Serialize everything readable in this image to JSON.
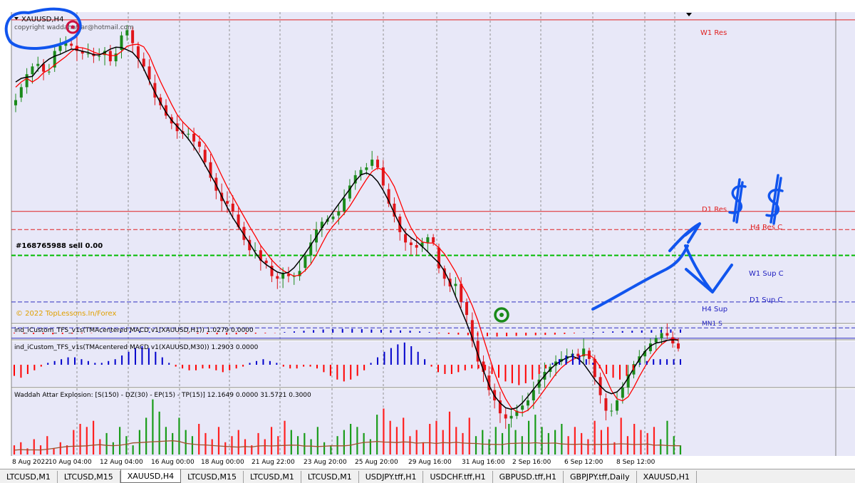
{
  "window": {
    "symbol_title": "XAUUSD,H4",
    "copyright": "copyright waddahattar@hotmail.com",
    "watermark": "© 2022 TopLessons.In/Forex",
    "order_label": "#168765988 sell 0.00"
  },
  "colors": {
    "plot_bg": "#e8e8f8",
    "bull": "#1b8a1b",
    "bear": "#e0161b",
    "tma_red": "#ff0000",
    "tma_black": "#000000",
    "macd_blue": "#0000cc",
    "macd_red": "#ff0000",
    "waddah_green": "#1a9c1a",
    "waddah_red": "#ff2020",
    "waddah_line": "#a0522d",
    "res_line": "#e02020",
    "sup_line": "#3030c0",
    "order_line": "#00bb00",
    "annotation": "#1155ee"
  },
  "chart_data": [
    {
      "type": "candlestick",
      "title": "XAUUSD,H4",
      "x_ticks": [
        "8 Aug 2022",
        "10 Aug 04:00",
        "12 Aug 04:00",
        "16 Aug 00:00",
        "18 Aug 00:00",
        "21 Aug 22:00",
        "23 Aug 20:00",
        "25 Aug 20:00",
        "29 Aug 16:00",
        "31 Aug 16:00",
        "2 Sep 16:00",
        "6 Sep 12:00",
        "8 Sep 12:00"
      ],
      "ylim": [
        1690,
        1810
      ],
      "closes": [
        1776,
        1781,
        1786,
        1789,
        1790,
        1787,
        1787,
        1795,
        1797,
        1798,
        1797,
        1795,
        1794,
        1794,
        1793,
        1793,
        1795,
        1791,
        1794,
        1801,
        1803,
        1798,
        1792,
        1789,
        1784,
        1777,
        1774,
        1770,
        1767,
        1764,
        1763,
        1763,
        1760,
        1758,
        1752,
        1746,
        1741,
        1737,
        1736,
        1733,
        1727,
        1722,
        1718,
        1718,
        1714,
        1713,
        1708,
        1707,
        1709,
        1708,
        1708,
        1710,
        1716,
        1721,
        1726,
        1729,
        1730,
        1731,
        1733,
        1738,
        1743,
        1747,
        1749,
        1750,
        1753,
        1750,
        1743,
        1736,
        1731,
        1725,
        1721,
        1720,
        1719,
        1721,
        1723,
        1721,
        1711,
        1707,
        1704,
        1705,
        1698,
        1693,
        1683,
        1675,
        1671,
        1664,
        1660,
        1655,
        1653,
        1654,
        1656,
        1658,
        1660,
        1664,
        1668,
        1671,
        1673,
        1675,
        1676,
        1677,
        1678,
        1677,
        1680,
        1676,
        1669,
        1662,
        1656,
        1656,
        1660,
        1665,
        1670,
        1674,
        1677,
        1679,
        1682,
        1684,
        1686,
        1685,
        1682,
        1680
      ],
      "bull_color": "#1b8a1b",
      "bear_color": "#e0161b"
    },
    {
      "type": "bar",
      "title": "ind_iCustom_TFS_v1s(TMAcentered MACD v1(XAUUSD,H1)) 1.0279 0.0000",
      "values": [
        -0.1,
        -0.15,
        -0.2,
        -0.2,
        -0.25,
        -0.2,
        -0.15,
        -0.1,
        -0.05,
        0.05,
        0.1,
        0.15,
        0.2,
        0.2,
        0.15,
        0.1,
        0.05,
        -0.05,
        -0.1,
        -0.15,
        -0.2,
        -0.25,
        -0.3,
        -0.25,
        -0.2,
        -0.15,
        -0.1,
        -0.05,
        0.1,
        0.2,
        0.3,
        0.4,
        0.5,
        0.55,
        0.6,
        0.6,
        0.55,
        0.5,
        0.45,
        0.4,
        0.35,
        0.3,
        0.2,
        0.1,
        -0.1,
        -0.2,
        -0.3,
        -0.4,
        -0.5,
        -0.55,
        -0.6,
        -0.55,
        -0.5,
        -0.45,
        -0.4,
        -0.35,
        -0.3,
        -0.2,
        -0.1,
        0.05,
        0.1,
        0.15,
        0.2,
        0.25,
        0.3,
        0.35,
        0.4,
        0.45,
        0.5,
        0.5
      ]
    },
    {
      "type": "bar",
      "title": "ind_iCustom_TFS_v1s(TMAcentered MACD v1(XAUUSD,M30)) 1.2903 0.0000",
      "values": [
        -0.6,
        -0.7,
        -0.5,
        -0.3,
        -0.1,
        0.1,
        0.2,
        0.3,
        0.4,
        0.4,
        0.3,
        0.2,
        0.1,
        0.1,
        0.2,
        0.3,
        0.5,
        0.7,
        0.9,
        1.0,
        0.9,
        0.7,
        0.4,
        0.1,
        -0.1,
        -0.2,
        -0.3,
        -0.3,
        -0.2,
        -0.2,
        -0.3,
        -0.4,
        -0.3,
        -0.2,
        -0.1,
        0.1,
        0.2,
        0.3,
        0.2,
        0.1,
        -0.1,
        -0.2,
        -0.2,
        -0.1,
        -0.1,
        -0.2,
        -0.4,
        -0.6,
        -0.8,
        -0.9,
        -0.8,
        -0.6,
        -0.3,
        0.1,
        0.4,
        0.7,
        0.9,
        1.1,
        1.2,
        1.0,
        0.7,
        0.3,
        -0.1,
        -0.4,
        -0.5,
        -0.5,
        -0.4,
        -0.3,
        -0.2,
        -0.2,
        -0.3,
        -0.5,
        -0.7,
        -0.9,
        -1.0,
        -1.1,
        -1.0,
        -0.8,
        -0.5,
        -0.2,
        0.1,
        0.3,
        0.5,
        0.6,
        0.5,
        0.3,
        0.1,
        -0.2,
        -0.5,
        -0.7,
        -0.8,
        -0.6,
        -0.3,
        0.1,
        0.2,
        0.3,
        0.3,
        0.3,
        0.3,
        0.3
      ]
    },
    {
      "type": "bar",
      "title": "Waddah Attar Explosion: [S(150) - DZ(30) - EP(15) - TP(15)] 12.1649 0.0000 31.5721 0.3000",
      "values": [
        3,
        4,
        2,
        5,
        3,
        6,
        2,
        4,
        3,
        8,
        10,
        9,
        11,
        5,
        7,
        4,
        9,
        6,
        3,
        8,
        12,
        18,
        14,
        9,
        7,
        12,
        8,
        6,
        10,
        7,
        5,
        9,
        4,
        6,
        8,
        5,
        3,
        7,
        5,
        9,
        6,
        11,
        8,
        6,
        7,
        5,
        9,
        4,
        3,
        6,
        8,
        10,
        9,
        7,
        5,
        13,
        15,
        11,
        9,
        12,
        6,
        8,
        4,
        10,
        11,
        8,
        14,
        9,
        7,
        12,
        6,
        8,
        5,
        9,
        7,
        10,
        8,
        6,
        11,
        13,
        9,
        7,
        8,
        10,
        6,
        9,
        7,
        5,
        11,
        8,
        9,
        4,
        12,
        6,
        10,
        8,
        7,
        9,
        5,
        11,
        6,
        3
      ]
    }
  ],
  "levels": {
    "w1_res": "W1 Res",
    "d1_res": "D1 Res",
    "h4_res_c": "H4 Res C",
    "w1_sup_c": "W1 Sup C",
    "d1_sup_c": "D1 Sup C",
    "h4_sup": "H4 Sup",
    "mn1_sup": "MN1 S"
  },
  "tabs": [
    {
      "label": "LTCUSD,M1"
    },
    {
      "label": "LTCUSD,M15"
    },
    {
      "label": "XAUUSD,H4",
      "active": true
    },
    {
      "label": "LTCUSD,M15"
    },
    {
      "label": "LTCUSD,M1"
    },
    {
      "label": "LTCUSD,M1"
    },
    {
      "label": "USDJPY.tff,H1"
    },
    {
      "label": "USDCHF.tff,H1"
    },
    {
      "label": "GBPUSD.tff,H1"
    },
    {
      "label": "GBPJPY.tff,Daily"
    },
    {
      "label": "XAUUSD,H1"
    }
  ]
}
